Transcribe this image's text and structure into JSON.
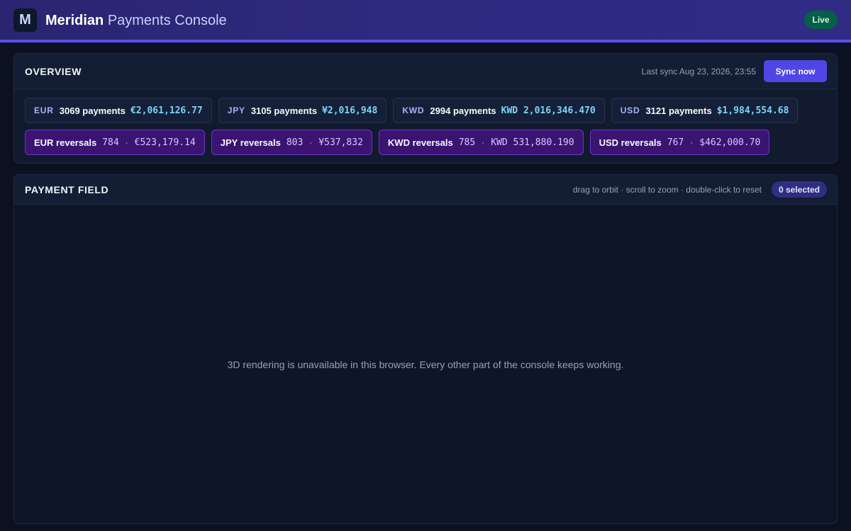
{
  "header": {
    "logo_letter": "M",
    "brand_name": "Meridian",
    "brand_suffix": "Payments Console",
    "status": "Live"
  },
  "overview": {
    "title": "OVERVIEW",
    "last_sync": "Last sync Aug 23, 2026, 23:55",
    "sync_button": "Sync now",
    "payments": [
      {
        "currency": "EUR",
        "count": "3069 payments",
        "amount": "€2,061,126.77"
      },
      {
        "currency": "JPY",
        "count": "3105 payments",
        "amount": "¥2,016,948"
      },
      {
        "currency": "KWD",
        "count": "2994 payments",
        "amount": "KWD 2,016,346.470"
      },
      {
        "currency": "USD",
        "count": "3121 payments",
        "amount": "$1,984,554.68"
      }
    ],
    "reversals": [
      {
        "label": "EUR reversals",
        "count": "784",
        "amount": "€523,179.14"
      },
      {
        "label": "JPY reversals",
        "count": "803",
        "amount": "¥537,832"
      },
      {
        "label": "KWD reversals",
        "count": "785",
        "amount": "KWD 531,880.190"
      },
      {
        "label": "USD reversals",
        "count": "767",
        "amount": "$462,000.70"
      }
    ],
    "separator": "·"
  },
  "field": {
    "title": "PAYMENT FIELD",
    "hint": "drag to orbit · scroll to zoom · double-click to reset",
    "selected": "0 selected",
    "unavailable": "3D rendering is unavailable in this browser. Every other part of the console keeps working."
  },
  "colors": {
    "accent": "#5046e5",
    "live": "#065f46",
    "reversal": "#3b1472"
  }
}
